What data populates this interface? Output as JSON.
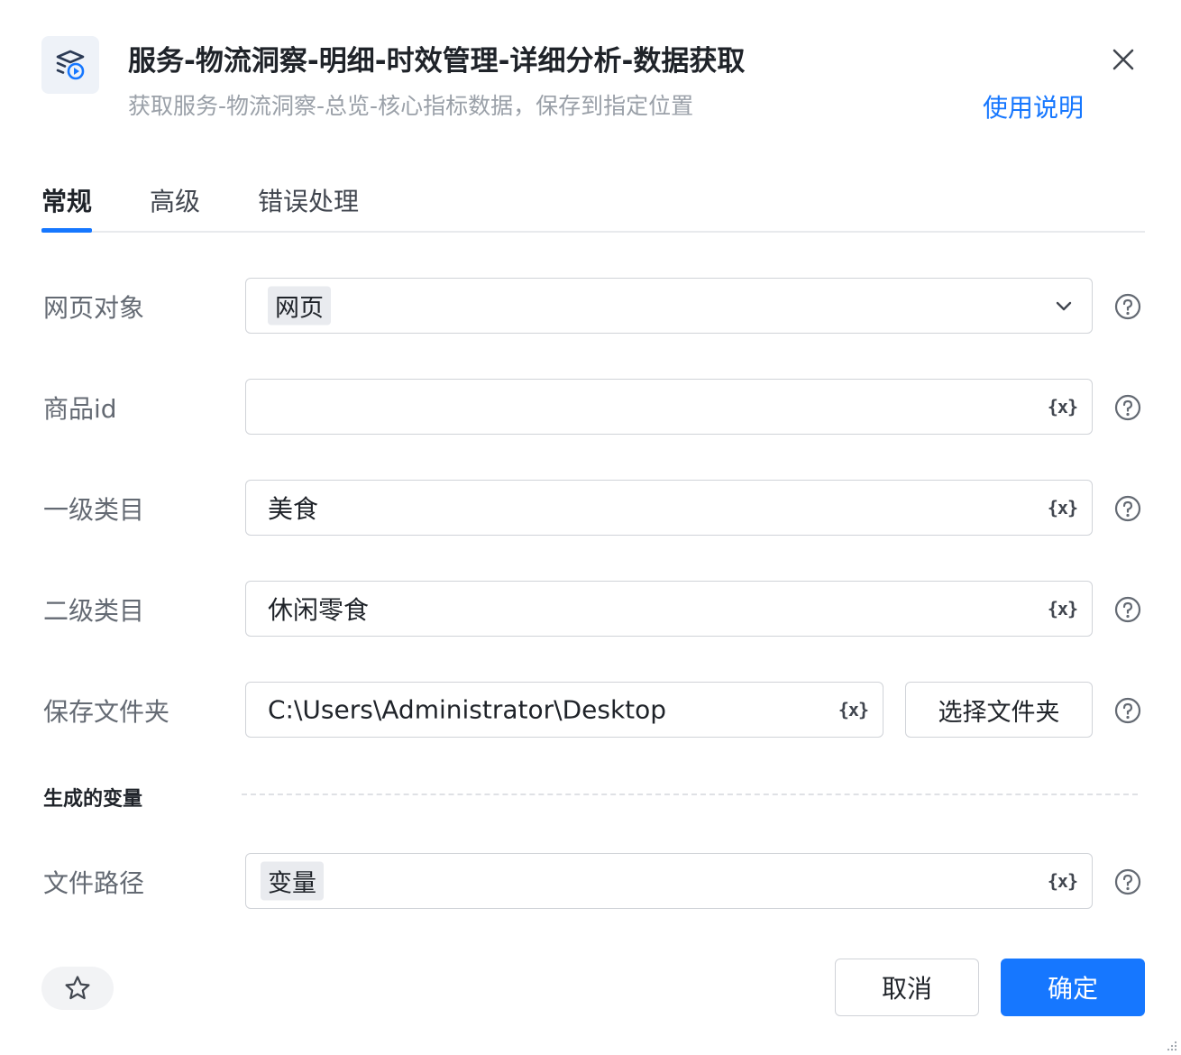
{
  "header": {
    "title": "服务-物流洞察-明细-时效管理-详细分析-数据获取",
    "subtitle": "获取服务-物流洞察-总览-核心指标数据，保存到指定位置",
    "help_link": "使用说明",
    "icon": "module-play-icon",
    "close_icon": "close-icon"
  },
  "tabs": [
    {
      "label": "常规",
      "active": true
    },
    {
      "label": "高级",
      "active": false
    },
    {
      "label": "错误处理",
      "active": false
    }
  ],
  "fields": {
    "web_object": {
      "label": "网页对象",
      "value": "网页"
    },
    "product_id": {
      "label": "商品id",
      "value": ""
    },
    "category_1": {
      "label": "一级类目",
      "value": "美食"
    },
    "category_2": {
      "label": "二级类目",
      "value": "休闲零食"
    },
    "save_folder": {
      "label": "保存文件夹",
      "value": "C:\\Users\\Administrator\\Desktop",
      "button": "选择文件夹"
    }
  },
  "variable_icon_text": "{x}",
  "generated": {
    "section_title": "生成的变量",
    "file_path": {
      "label": "文件路径",
      "value": "变量"
    }
  },
  "footer": {
    "cancel": "取消",
    "confirm": "确定"
  },
  "colors": {
    "accent": "#1677ff",
    "border": "#d0d3d8",
    "label": "#646a73"
  }
}
